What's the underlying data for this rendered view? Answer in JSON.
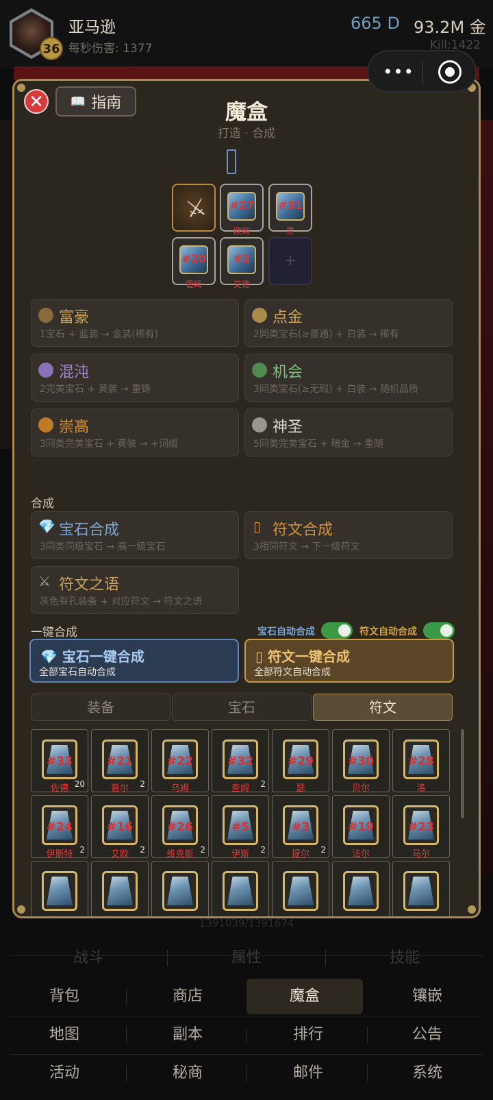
{
  "player": {
    "name": "亚马逊",
    "level": "36",
    "dps": "每秒伤害: 1377",
    "diamonds": "665 D",
    "gold": "93.2M 金",
    "kill": "Kill:1422"
  },
  "capsule": {
    "more": "•••"
  },
  "panel": {
    "close": "✕",
    "guide_icon": "📖",
    "guide_label": "指南",
    "title": "魔盒",
    "subtitle": "打造 · 合成"
  },
  "slots": [
    {
      "type": "weapon",
      "icon": "sword-icon"
    },
    {
      "type": "rune",
      "num": "#27",
      "name": "欧姆"
    },
    {
      "type": "rune",
      "num": "#31",
      "name": "贾"
    },
    {
      "type": "rune",
      "num": "#20",
      "name": "雷姆"
    },
    {
      "type": "rune",
      "num": "#2",
      "name": "艾德"
    },
    {
      "type": "empty",
      "plus": "+"
    }
  ],
  "recipes": [
    {
      "title": "富豪",
      "desc": "1宝石 + 蓝装 → 金装(稀有)",
      "color": "#c9a15a",
      "icon_color": "#8a6a3a"
    },
    {
      "title": "点金",
      "desc": "2同类宝石(≥普通) + 白装 → 稀有",
      "color": "#c9a15a",
      "icon_color": "#a88a4a"
    },
    {
      "title": "混沌",
      "desc": "2完美宝石 + 黄装 → 重铸",
      "color": "#a58bd0",
      "icon_color": "#8a72b8"
    },
    {
      "title": "机会",
      "desc": "3同类宝石(≥无瑕) + 白装 → 随机品质",
      "color": "#7cc07c",
      "icon_color": "#4f8a4f"
    },
    {
      "title": "崇高",
      "desc": "3同类完美宝石 + 黄装 → +词缀",
      "color": "#d4923a",
      "icon_color": "#c07a28"
    },
    {
      "title": "神圣",
      "desc": "5同类完美宝石 + 暗金 → 重随",
      "color": "#d8d2c8",
      "icon_color": "#9a958d"
    }
  ],
  "synthesis_label": "合成",
  "synthesis": [
    {
      "icon": "💎",
      "title": "宝石合成",
      "desc": "3同类同级宝石 → 高一级宝石",
      "color": "#7aa6d6"
    },
    {
      "icon": "▯",
      "title": "符文合成",
      "desc": "3相同符文 → 下一级符文",
      "color": "#d4923a"
    },
    {
      "icon": "⚔",
      "title": "符文之语",
      "desc": "灰色有孔装备 + 对应符文 → 符文之语",
      "color": "#c9a15a"
    }
  ],
  "one_click_label": "一键合成",
  "toggles": [
    {
      "label": "宝石自动合成",
      "color": "#7aa6d6",
      "on": true
    },
    {
      "label": "符文自动合成",
      "color": "#d4a33a",
      "on": true
    }
  ],
  "one_click": [
    {
      "icon": "💎",
      "title": "宝石一键合成",
      "sub": "全部宝石自动合成"
    },
    {
      "icon": "▯",
      "title": "符文一键合成",
      "sub": "全部符文自动合成"
    }
  ],
  "tabs": [
    "装备",
    "宝石",
    "符文"
  ],
  "active_tab": 2,
  "runes": [
    {
      "num": "#33",
      "name": "佐德",
      "count": "20"
    },
    {
      "num": "#21",
      "name": "普尔",
      "count": "2"
    },
    {
      "num": "#22",
      "name": "乌姆",
      "count": ""
    },
    {
      "num": "#32",
      "name": "查姆",
      "count": "2"
    },
    {
      "num": "#29",
      "name": "瑟",
      "count": ""
    },
    {
      "num": "#30",
      "name": "贝尔",
      "count": ""
    },
    {
      "num": "#28",
      "name": "洛",
      "count": ""
    },
    {
      "num": "#24",
      "name": "伊斯特",
      "count": "2"
    },
    {
      "num": "#16",
      "name": "艾欧",
      "count": "2"
    },
    {
      "num": "#26",
      "name": "维克斯",
      "count": "2"
    },
    {
      "num": "#5",
      "name": "伊斯",
      "count": "2"
    },
    {
      "num": "#3",
      "name": "提尔",
      "count": "2"
    },
    {
      "num": "#19",
      "name": "法尔",
      "count": ""
    },
    {
      "num": "#23",
      "name": "马尔",
      "count": ""
    },
    {
      "num": "",
      "name": "",
      "count": ""
    },
    {
      "num": "",
      "name": "",
      "count": ""
    },
    {
      "num": "",
      "name": "",
      "count": ""
    },
    {
      "num": "",
      "name": "",
      "count": ""
    },
    {
      "num": "",
      "name": "",
      "count": ""
    },
    {
      "num": "",
      "name": "",
      "count": ""
    },
    {
      "num": "",
      "name": "",
      "count": ""
    }
  ],
  "exp_text": "1391039/1391674",
  "nav": {
    "row1": [
      "战斗",
      "属性",
      "技能"
    ],
    "row2": [
      "背包",
      "商店",
      "魔盒",
      "镶嵌"
    ],
    "row3": [
      "地图",
      "副本",
      "排行",
      "公告"
    ],
    "row4": [
      "活动",
      "秘商",
      "邮件",
      "系统"
    ],
    "active": "魔盒"
  }
}
